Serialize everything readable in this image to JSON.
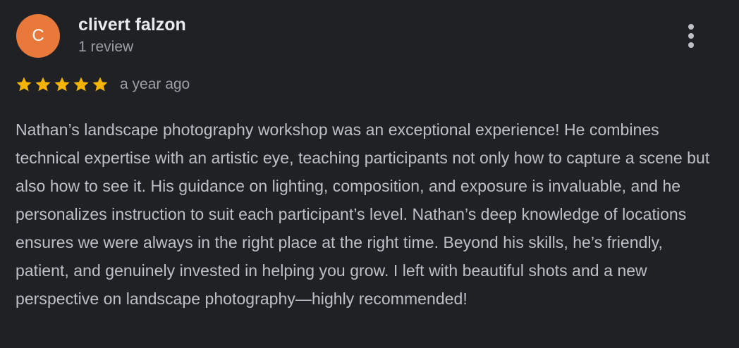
{
  "reviewer": {
    "initial": "C",
    "name": "clivert falzon",
    "meta": "1 review",
    "avatar_color": "#e8793a"
  },
  "review": {
    "rating": 5,
    "rating_max": 5,
    "star_color": "#f4b400",
    "time": "a year ago",
    "text": "Nathan’s landscape photography workshop was an exceptional experience! He combines technical expertise with an artistic eye, teaching participants not only how to capture a scene but also how to see it. His guidance on lighting, composition, and exposure is invaluable, and he personalizes instruction to suit each participant’s level. Nathan’s deep knowledge of locations ensures we were always in the right place at the right time. Beyond his skills, he’s friendly, patient, and genuinely invested in helping you grow. I left with beautiful shots and a new perspective on landscape photography—highly recommended!"
  },
  "icons": {
    "more": "more-vert-icon",
    "star": "star-icon"
  }
}
